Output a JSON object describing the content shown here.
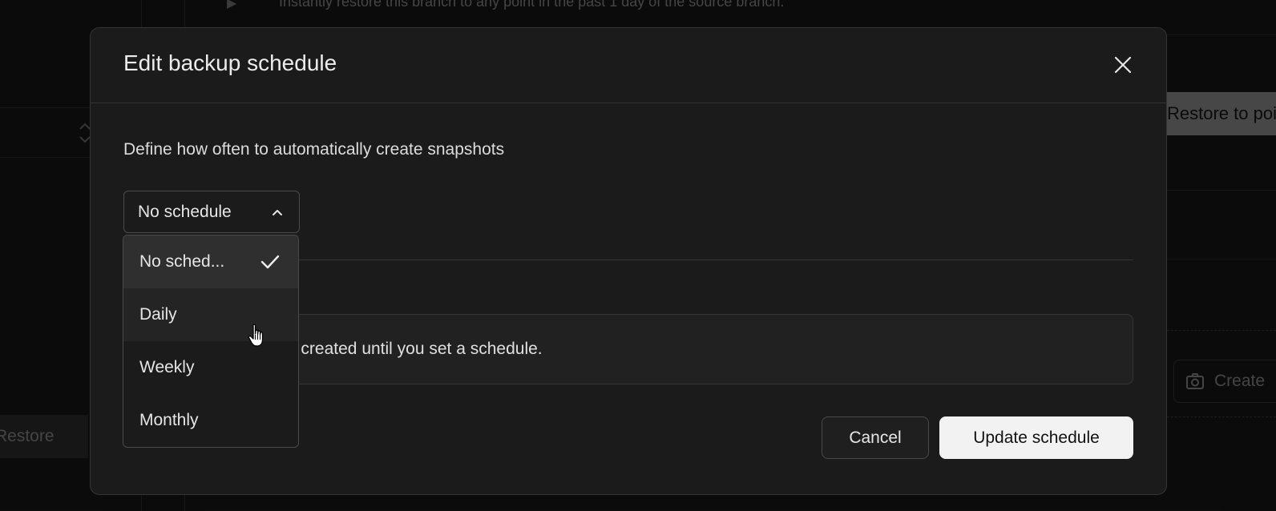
{
  "background": {
    "top_text": "Instantly restore this branch to any point in the past 1 day of the source branch.",
    "restore_to_point_label": "Restore to point",
    "create_label": "Create",
    "restore_label": "Restore"
  },
  "modal": {
    "title": "Edit backup schedule",
    "description": "Define how often to automatically create snapshots",
    "select": {
      "value": "No schedule",
      "options": [
        {
          "label": "No sched...",
          "selected": true
        },
        {
          "label": "Daily",
          "selected": false
        },
        {
          "label": "Weekly",
          "selected": false
        },
        {
          "label": "Monthly",
          "selected": false
        }
      ]
    },
    "info_text": "No snapshots will be created until you set a schedule.",
    "cancel_label": "Cancel",
    "update_label": "Update schedule"
  },
  "icons": {
    "close": "close-icon",
    "chevron": "chevron-up-icon",
    "check": "check-icon",
    "camera": "camera-icon",
    "cursor": "pointer-hand-icon"
  }
}
